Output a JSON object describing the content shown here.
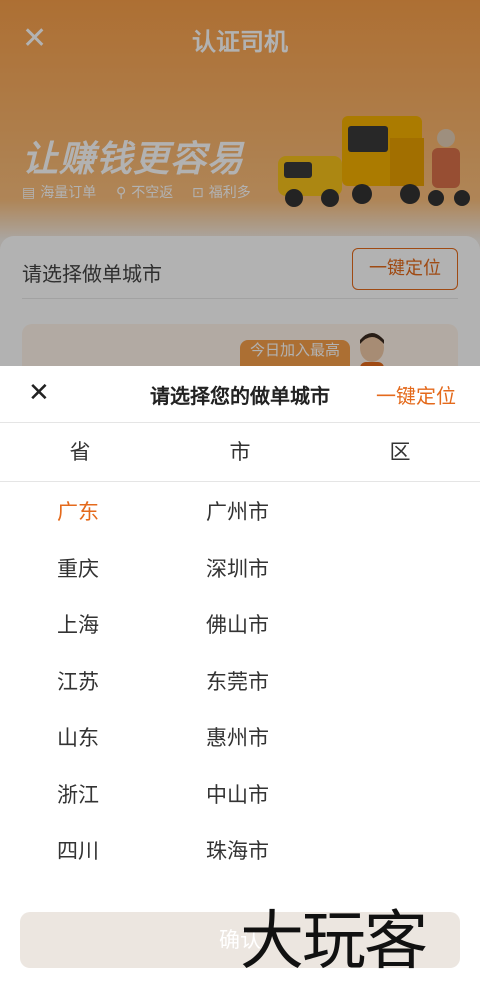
{
  "header": {
    "title": "认证司机",
    "close_icon": "close-icon"
  },
  "banner": {
    "slogan": "让赚钱更容易",
    "features": [
      "海量订单",
      "不空返",
      "福利多"
    ]
  },
  "card": {
    "city_label": "请选择做单城市",
    "locate_button": "一键定位",
    "promo_tag": "今日加入最高"
  },
  "picker": {
    "title": "请选择您的做单城市",
    "locate_label": "一键定位",
    "tabs": [
      "省",
      "市",
      "区"
    ],
    "provinces": [
      "广东",
      "重庆",
      "上海",
      "江苏",
      "山东",
      "浙江",
      "四川"
    ],
    "selected_province": "广东",
    "cities": [
      "广州市",
      "深圳市",
      "佛山市",
      "东莞市",
      "惠州市",
      "中山市",
      "珠海市"
    ],
    "confirm": "确认"
  },
  "watermark": "大玩客",
  "colors": {
    "accent": "#e46a1c",
    "banner": "#f8a04a",
    "confirm_bg": "#ece6e0"
  }
}
